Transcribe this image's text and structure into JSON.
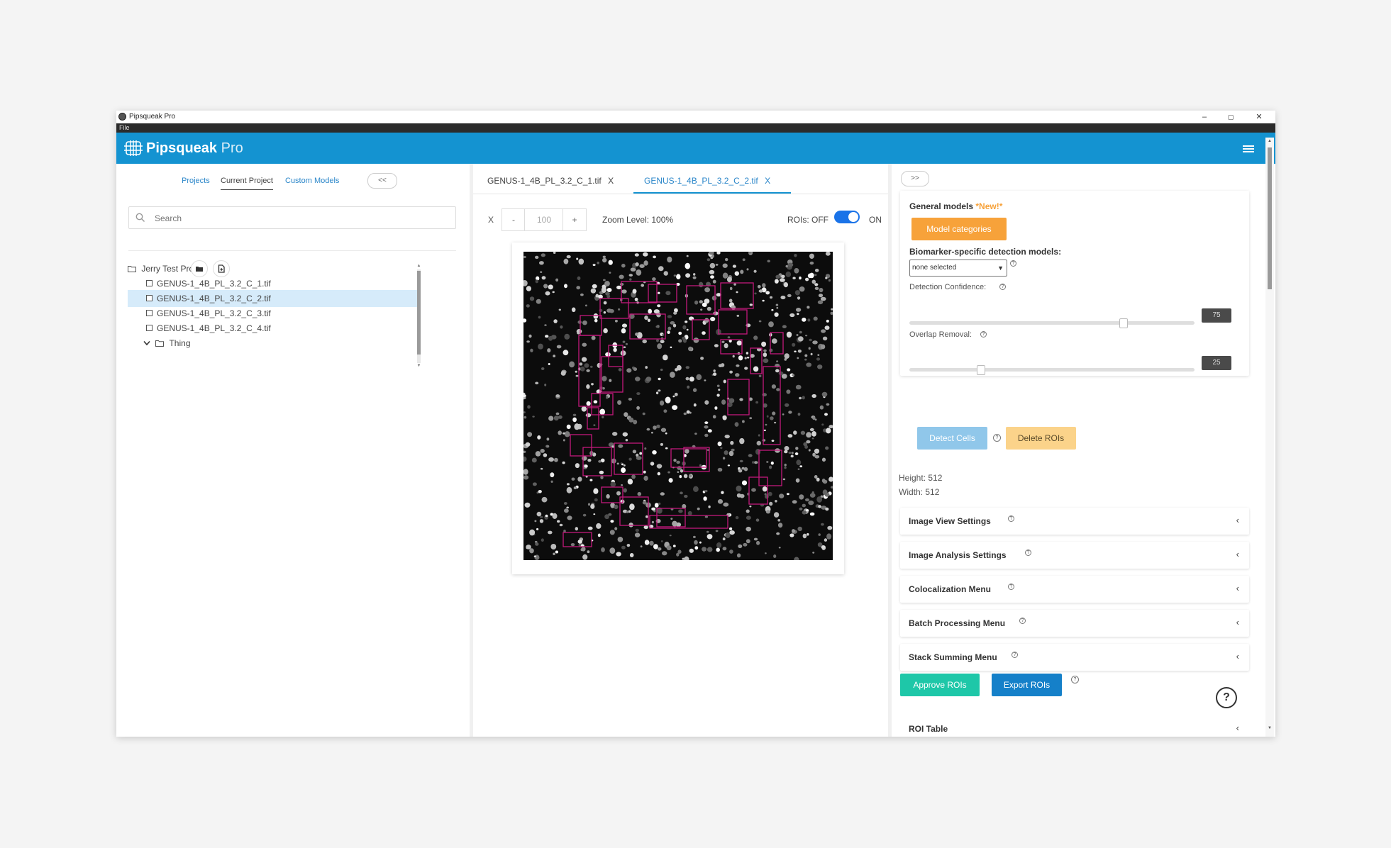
{
  "window": {
    "title": "Pipsqueak Pro",
    "controls": {
      "minimize": "–",
      "maximize": "▢",
      "close": "✕"
    }
  },
  "menu": {
    "file": "File"
  },
  "brand": {
    "name": "Pipsqueak",
    "suffix": "Pro",
    "color": "#1493d1"
  },
  "left": {
    "tabs": [
      "Projects",
      "Current Project",
      "Custom Models"
    ],
    "active_tab": "Current Project",
    "collapse_label": "<<",
    "search_placeholder": "Search",
    "tree": {
      "root": "Jerry Test Proj",
      "files": [
        "GENUS-1_4B_PL_3.2_C_1.tif",
        "GENUS-1_4B_PL_3.2_C_2.tif",
        "GENUS-1_4B_PL_3.2_C_3.tif",
        "GENUS-1_4B_PL_3.2_C_4.tif"
      ],
      "selected_index": 1,
      "folder": "Thing"
    }
  },
  "center": {
    "tabs": [
      {
        "label": "GENUS-1_4B_PL_3.2_C_1.tif",
        "close": "X"
      },
      {
        "label": "GENUS-1_4B_PL_3.2_C_2.tif",
        "close": "X"
      }
    ],
    "active_tab": 1,
    "zoom": {
      "reset": "X",
      "minus": "-",
      "value": "100",
      "plus": "+",
      "label": "Zoom Level: 100%"
    },
    "rois": {
      "off": "ROIs: OFF",
      "on": "ON",
      "enabled": true
    },
    "roi_color": "#c2187c"
  },
  "right": {
    "expand_label": ">>",
    "general_models": "General models",
    "new_badge": "*New!*",
    "model_categories": "Model categories",
    "biomarker_label": "Biomarker-specific detection models:",
    "model_select": "none selected",
    "detection_confidence": {
      "label": "Detection Confidence:",
      "value": "75",
      "fraction": 0.75
    },
    "overlap_removal": {
      "label": "Overlap Removal:",
      "value": "25",
      "fraction": 0.25
    },
    "detect_cells": "Detect Cells",
    "delete_rois": "Delete ROIs",
    "height": "Height: 512",
    "width": "Width: 512",
    "sections": [
      "Image View Settings",
      "Image Analysis Settings",
      "Colocalization Menu",
      "Batch Processing Menu",
      "Stack Summing Menu"
    ],
    "approve_rois": "Approve ROIs",
    "export_rois": "Export ROIs",
    "help": "?",
    "roi_table": "ROI Table"
  },
  "colors": {
    "accent": "#1493d1",
    "orange": "#f7a23a",
    "teal": "#1ec7a8",
    "export_blue": "#1580c9",
    "detect_blue": "#90c7ea",
    "delete_yellow": "#fbd38a"
  }
}
